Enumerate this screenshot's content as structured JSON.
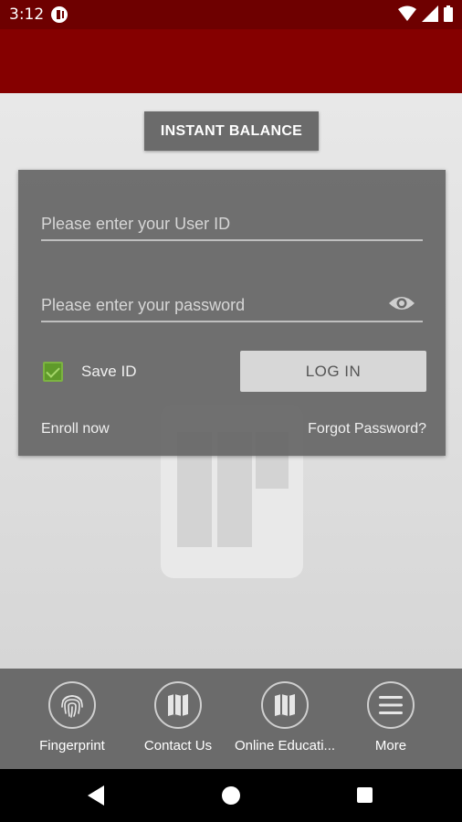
{
  "status_bar": {
    "time": "3:12"
  },
  "login": {
    "instant_balance_label": "INSTANT BALANCE",
    "userid_placeholder": "Please enter your User ID",
    "password_placeholder": "Please enter your password",
    "save_id_label": "Save ID",
    "save_id_checked": true,
    "login_button_label": "LOG IN",
    "enroll_label": "Enroll now",
    "forgot_label": "Forgot Password?"
  },
  "bottom_nav": {
    "items": [
      {
        "label": "Fingerprint",
        "icon": "fingerprint-icon"
      },
      {
        "label": "Contact Us",
        "icon": "map-icon"
      },
      {
        "label": "Online Educati...",
        "icon": "map-icon"
      },
      {
        "label": "More",
        "icon": "menu-icon"
      }
    ]
  },
  "colors": {
    "status_bar": "#6e0000",
    "app_bar": "#850000",
    "card": "#666666",
    "checkbox": "#5f9a2a",
    "nav_bar": "#6b6b6b"
  }
}
